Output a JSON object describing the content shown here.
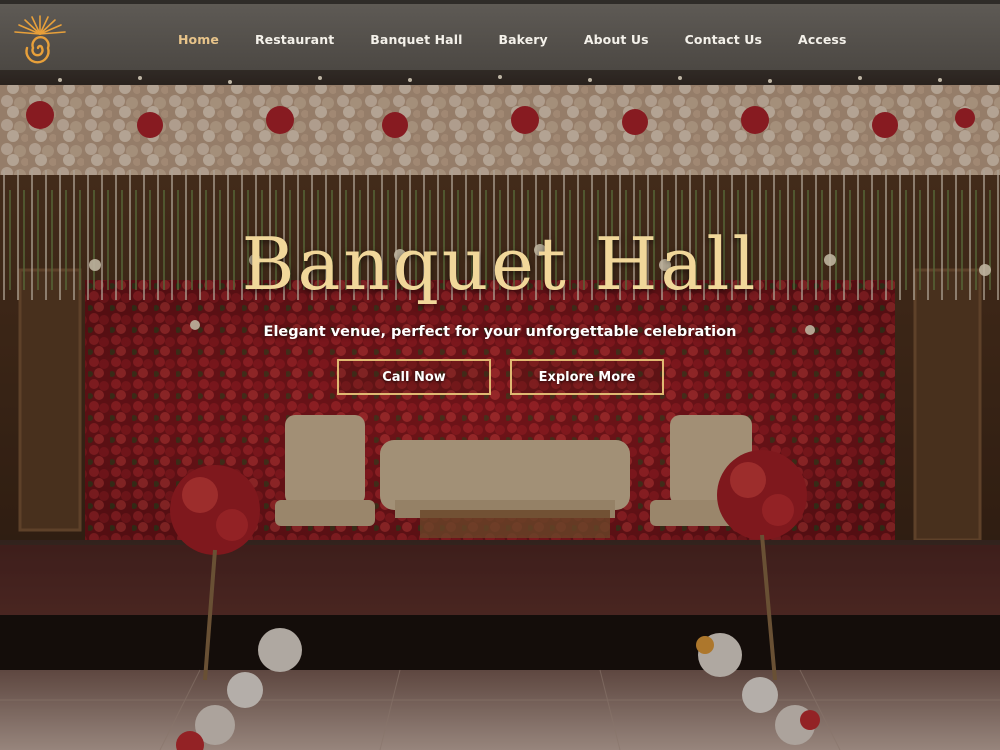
{
  "nav": {
    "items": [
      {
        "label": "Home",
        "active": true
      },
      {
        "label": "Restaurant",
        "active": false
      },
      {
        "label": "Banquet Hall",
        "active": false
      },
      {
        "label": "Bakery",
        "active": false
      },
      {
        "label": "About Us",
        "active": false
      },
      {
        "label": "Contact Us",
        "active": false
      },
      {
        "label": "Access",
        "active": false
      }
    ]
  },
  "logo": {
    "icon": "sun-spiral-logo",
    "color": "#e8a03a"
  },
  "hero": {
    "title": "Banquet Hall",
    "subtitle": "Elegant venue, perfect for your unforgettable celebration",
    "call_button": "Call Now",
    "explore_button": "Explore More"
  },
  "colors": {
    "header_bg": "#55514c",
    "nav_active": "#e8c48a",
    "title_gold": "#f1d79a",
    "button_border": "#e0b972"
  }
}
